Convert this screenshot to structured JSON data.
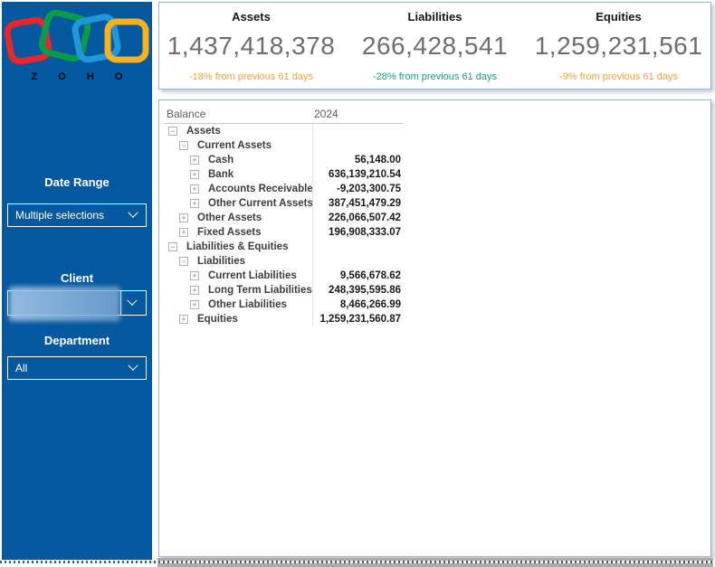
{
  "brand": {
    "logo_text": "Z O H O",
    "logo_colors": {
      "red": "#E8262B",
      "green": "#0A9A4A",
      "blue": "#2196DB",
      "yellow": "#F9B21D"
    },
    "sidebar_bg": "#04589E"
  },
  "sidebar": {
    "filters": [
      {
        "label": "Date Range",
        "value": "Multiple selections",
        "redacted": false
      },
      {
        "label": "Client",
        "value": "",
        "redacted": true
      },
      {
        "label": "Department",
        "value": "All",
        "redacted": false
      }
    ]
  },
  "kpis": [
    {
      "title": "Assets",
      "value": "1,437,418,378",
      "delta": "-18% from previous 61 days",
      "delta_color": "#F2A33C"
    },
    {
      "title": "Liabilities",
      "value": "266,428,541",
      "delta": "-28% from previous 61 days",
      "delta_color": "#18A07E"
    },
    {
      "title": "Equities",
      "value": "1,259,231,561",
      "delta": "-9% from previous 61 days",
      "delta_color": "#F2A33C"
    }
  ],
  "matrix": {
    "columns": [
      "Balance",
      "2024"
    ],
    "rows": [
      {
        "label": "Assets",
        "level": 0,
        "expanded": true,
        "value": ""
      },
      {
        "label": "Current Assets",
        "level": 1,
        "expanded": true,
        "value": ""
      },
      {
        "label": "Cash",
        "level": 2,
        "expanded": false,
        "value": "56,148.00"
      },
      {
        "label": "Bank",
        "level": 2,
        "expanded": false,
        "value": "636,139,210.54"
      },
      {
        "label": "Accounts Receivable",
        "level": 2,
        "expanded": false,
        "value": "-9,203,300.75"
      },
      {
        "label": "Other Current Assets",
        "level": 2,
        "expanded": false,
        "value": "387,451,479.29"
      },
      {
        "label": "Other Assets",
        "level": 1,
        "expanded": false,
        "value": "226,066,507.42"
      },
      {
        "label": "Fixed Assets",
        "level": 1,
        "expanded": false,
        "value": "196,908,333.07"
      },
      {
        "label": "Liabilities & Equities",
        "level": 0,
        "expanded": true,
        "value": ""
      },
      {
        "label": "Liabilities",
        "level": 1,
        "expanded": true,
        "value": ""
      },
      {
        "label": "Current Liabilities",
        "level": 2,
        "expanded": false,
        "value": "9,566,678.62"
      },
      {
        "label": "Long Term Liabilities",
        "level": 2,
        "expanded": false,
        "value": "248,395,595.86"
      },
      {
        "label": "Other Liabilities",
        "level": 2,
        "expanded": false,
        "value": "8,466,266.99"
      },
      {
        "label": "Equities",
        "level": 1,
        "expanded": false,
        "value": "1,259,231,560.87"
      }
    ]
  }
}
